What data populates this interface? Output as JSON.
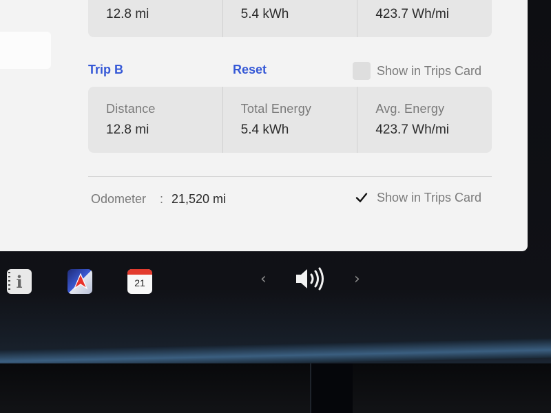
{
  "trip_a_partial": {
    "distance_value": "12.8 mi",
    "energy_value": "5.4 kWh",
    "avg_value": "423.7 Wh/mi"
  },
  "trip_b": {
    "title": "Trip B",
    "reset_label": "Reset",
    "show_in_trips_card_label": "Show in Trips Card",
    "show_in_trips_card_checked": false,
    "stats": {
      "distance_label": "Distance",
      "distance_value": "12.8 mi",
      "energy_label": "Total Energy",
      "energy_value": "5.4 kWh",
      "avg_label": "Avg. Energy",
      "avg_value": "423.7 Wh/mi"
    }
  },
  "odometer": {
    "label": "Odometer",
    "separator": ":",
    "value": "21,520 mi",
    "show_in_trips_card_label": "Show in Trips Card",
    "show_in_trips_card_checked": true
  },
  "taskbar": {
    "manual_icon": "owners-manual-icon",
    "nav_icon": "navigation-icon",
    "calendar_icon": "calendar-icon",
    "calendar_day": "21",
    "prev_arrow": "‹",
    "next_arrow": "›",
    "volume_icon": "volume-icon"
  },
  "colors": {
    "link_blue": "#3558d6",
    "panel_bg": "#f3f3f3",
    "card_bg": "#e6e6e6",
    "calendar_red": "#e33b2e"
  }
}
